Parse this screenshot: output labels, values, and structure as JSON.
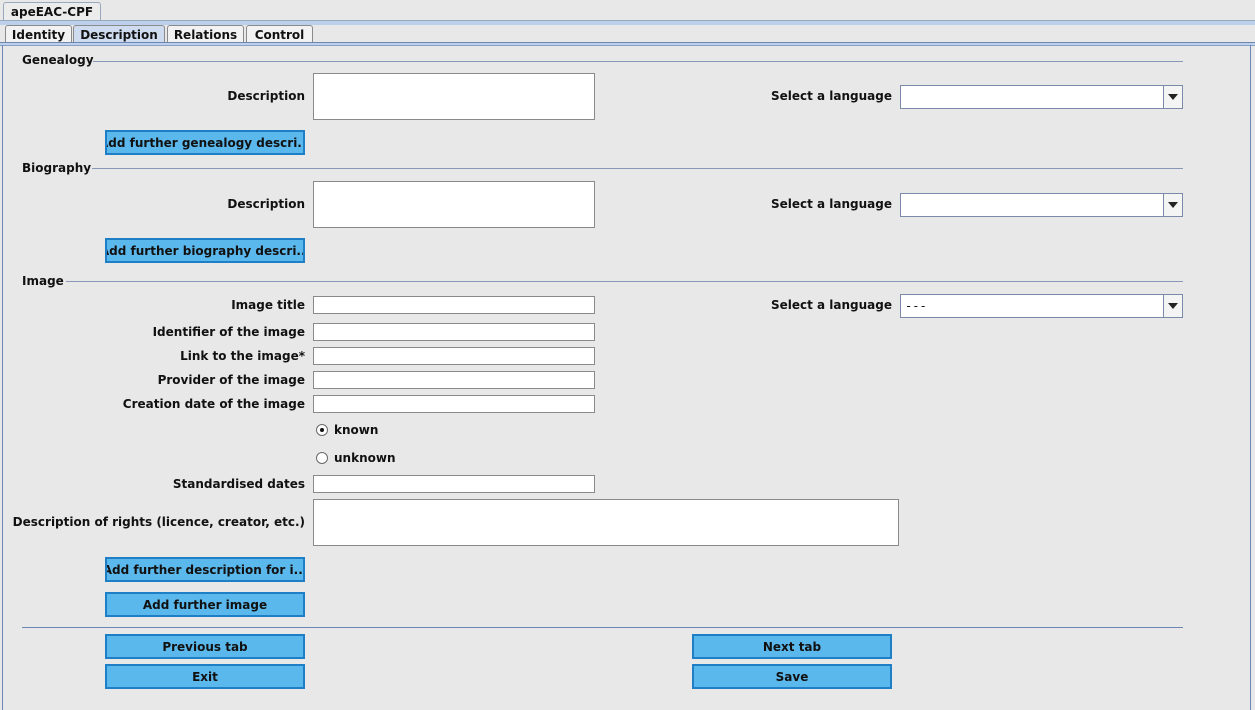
{
  "window": {
    "tab_label": "apeEAC-CPF"
  },
  "tabs": [
    {
      "label": "Identity"
    },
    {
      "label": "Description"
    },
    {
      "label": "Relations"
    },
    {
      "label": "Control"
    }
  ],
  "genealogy": {
    "title": "Genealogy",
    "description_label": "Description",
    "language_label": "Select a language",
    "language_value": "",
    "add_button": "Add further genealogy descri..."
  },
  "biography": {
    "title": "Biography",
    "description_label": "Description",
    "language_label": "Select a language",
    "language_value": "",
    "add_button": "Add further biography descri..."
  },
  "image": {
    "title": "Image",
    "image_title_label": "Image title",
    "language_label": "Select a language",
    "language_value": "---",
    "identifier_label": "Identifier of the image",
    "link_label": "Link to the image*",
    "provider_label": "Provider of the image",
    "creation_date_label": "Creation date of the image",
    "radio_known": "known",
    "radio_unknown": "unknown",
    "selected_radio": "known",
    "standardised_label": "Standardised dates",
    "rights_label": "Description of rights (licence, creator, etc.)",
    "add_description_button": "Add further description for i...",
    "add_image_button": "Add further image"
  },
  "footer": {
    "previous": "Previous tab",
    "next": "Next tab",
    "exit": "Exit",
    "save": "Save"
  }
}
